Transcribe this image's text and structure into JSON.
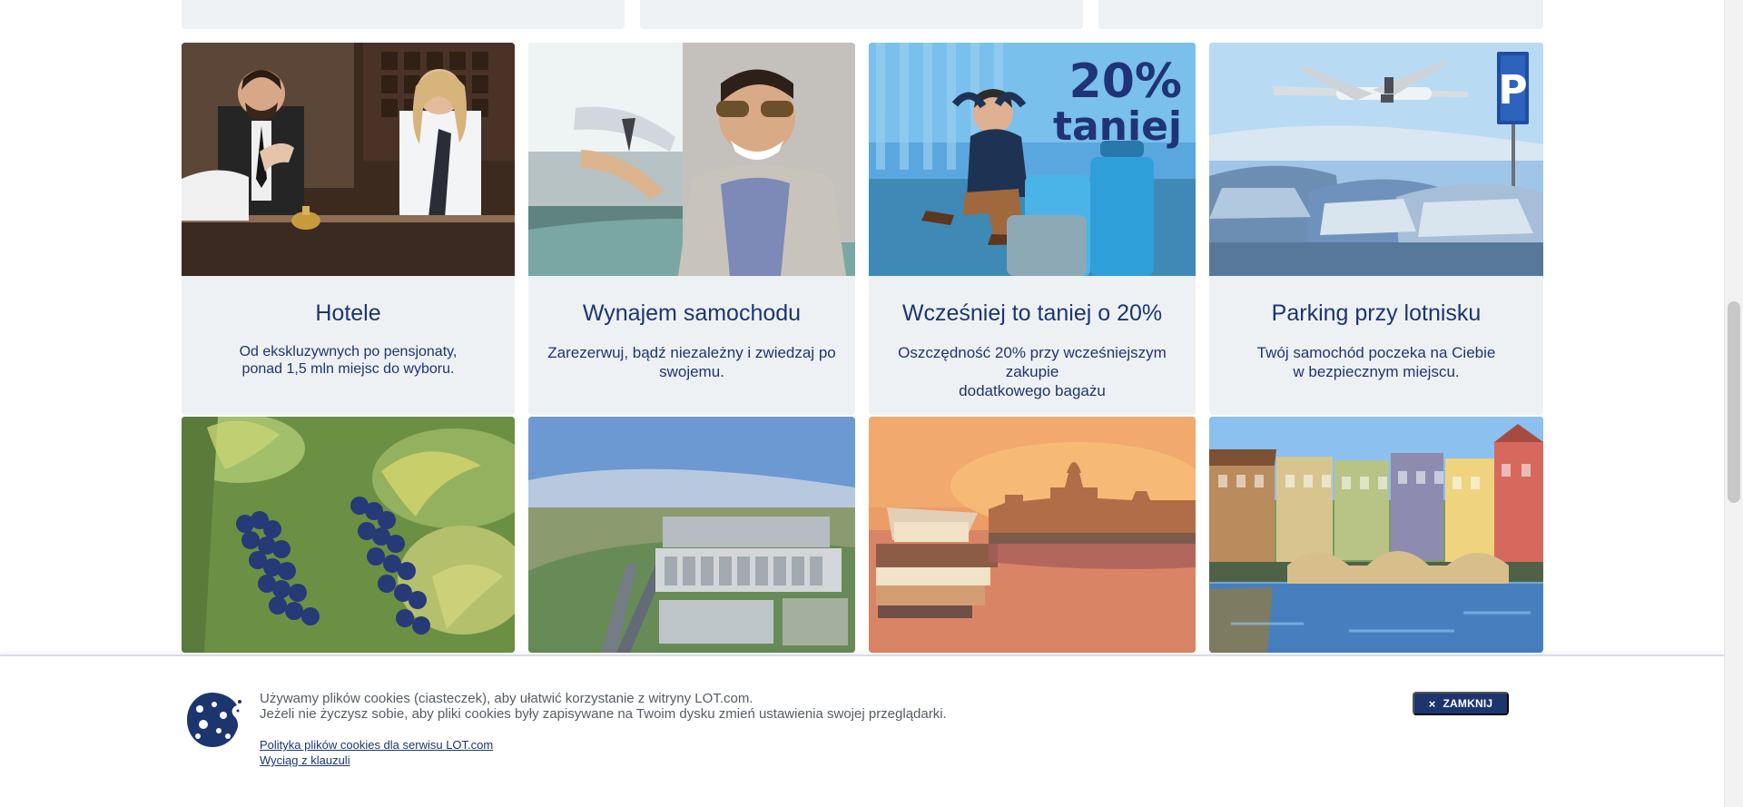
{
  "cards": [
    {
      "title": "Hotele",
      "desc": [
        "Od ekskluzywnych po pensjonaty,",
        "ponad 1,5 mln miejsc do wyboru."
      ]
    },
    {
      "title": "Wynajem samochodu",
      "desc": [
        "Zarezerwuj, bądź niezależny i zwiedzaj po",
        "swojemu."
      ]
    },
    {
      "title": "Wcześniej to taniej o 20%",
      "desc": [
        "Oszczędność 20% przy wcześniejszym zakupie",
        "dodatkowego bagażu"
      ],
      "image_text": [
        "20%",
        "taniej"
      ]
    },
    {
      "title": "Parking przy lotnisku",
      "desc": [
        "Twój samochód poczeka na Ciebie",
        "w bezpiecznym miejscu."
      ],
      "image_text": "P"
    }
  ],
  "cookie": {
    "line1": "Używamy plików cookies (ciasteczek), aby ułatwić korzystanie z witryny LOT.com.",
    "line2": "Jeżeli nie życzysz sobie, aby pliki cookies były zapisywane na Twoim dysku zmień ustawienia swojej przeglądarki.",
    "link1": "Polityka plików cookies dla serwisu LOT.com",
    "link2": "Wyciąg z klauzuli",
    "close_label": "ZAMKNIJ"
  },
  "colors": {
    "brand_navy": "#1d356f",
    "card_bg": "#eef1f4"
  },
  "icons": {
    "cookie": "cookie-icon",
    "close": "close-icon",
    "parking": "parking-sign-icon"
  }
}
